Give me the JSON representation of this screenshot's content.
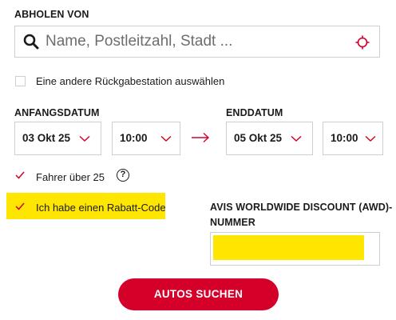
{
  "pickup": {
    "label": "ABHOLEN VON",
    "placeholder": "Name, Postleitzahl, Stadt ..."
  },
  "return_option": {
    "label": "Eine andere Rückgabestation auswählen",
    "checked": false
  },
  "start": {
    "label": "ANFANGSDATUM",
    "date": "03 Okt 25",
    "time": "10:00"
  },
  "end": {
    "label": "ENDDATUM",
    "date": "05 Okt 25",
    "time": "10:00"
  },
  "driver_age": {
    "label": "Fahrer über 25",
    "checked": true,
    "help_symbol": "?"
  },
  "discount_code": {
    "label": "Ich habe einen Rabatt-Code",
    "checked": true
  },
  "awd": {
    "label_line1": "AVIS WORLDWIDE DISCOUNT (AWD)-",
    "label_line2": "NUMMER"
  },
  "search_button": {
    "label": "AUTOS SUCHEN"
  },
  "colors": {
    "accent": "#d4002a",
    "highlight": "#ffe600",
    "border": "#cfcfcf"
  },
  "icons": {
    "search": "search-icon",
    "location": "crosshair-icon",
    "arrow": "arrow-right-icon",
    "chevron": "chevron-down-icon",
    "check": "checkmark-icon",
    "help": "question-circle-icon"
  }
}
